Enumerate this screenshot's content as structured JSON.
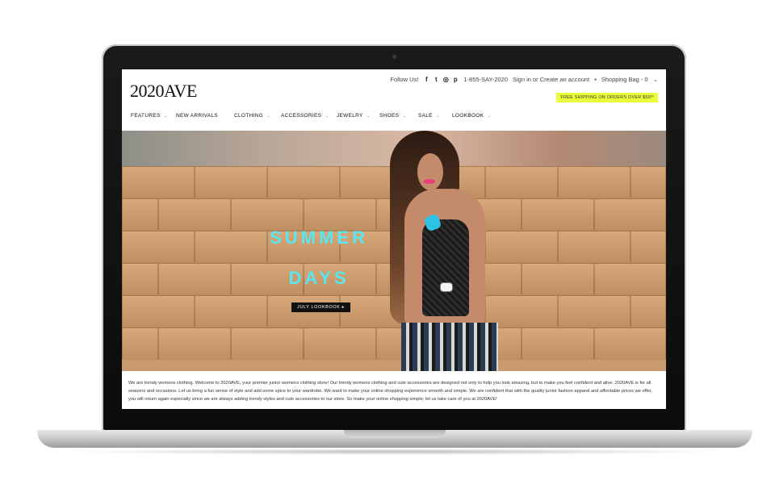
{
  "site": {
    "logo": "2020AVE",
    "follow_label": "Follow Us!",
    "social_icons": [
      "facebook-icon",
      "twitter-icon",
      "instagram-icon",
      "pinterest-icon"
    ],
    "phone": "1-855-SAY-2020",
    "account_link": "Sign in or Create an account",
    "bag_label": "Shopping Bag - 0",
    "promo_text": "FREE SHIPPING ON ORDERS OVER $50!*",
    "nav": [
      "FEATURES",
      "NEW ARRIVALS",
      "CLOTHING",
      "ACCESSORIES",
      "JEWELRY",
      "SHOES",
      "SALE",
      "LOOKBOOK"
    ]
  },
  "hero": {
    "headline_line1": "SUMMER",
    "headline_line2": "DAYS",
    "cta_label": "JULY LOOKBOOK ▸"
  },
  "about_text": "We are trendy womens clothing. Welcome to 2020AVE, your premier junior womens clothing store! Our trendy womens clothing and cute accessories are designed not only to help you look amazing, but to make you feel confident and alive. 2020AVE is for all seasons and occasions. Let us bring a fun sense of style and add some spice to your wardrobe. We want to make your online shopping experience smooth and simple. We are confident that with the quality junior fashion apparel and affordable prices we offer, you will return again especially since we are always adding trendy styles and cute accessories to our store. So make your online shopping simple; let us take care of you at 2020AVE!",
  "colors": {
    "promo_bg": "#e9ff3a",
    "headline": "#58e6f1",
    "cta_bg": "#111111"
  }
}
